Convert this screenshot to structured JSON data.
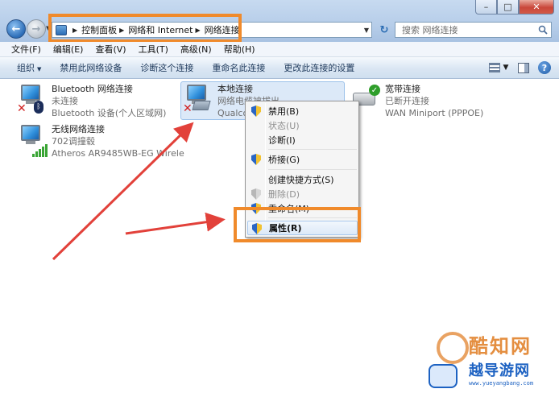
{
  "window": {
    "controls": {
      "minimize": "–",
      "maximize": "□",
      "close": "✕"
    }
  },
  "nav": {
    "back": "←",
    "forward": "→",
    "breadcrumbs": [
      "控制面板",
      "网络和 Internet",
      "网络连接"
    ],
    "refresh": "↻",
    "search_placeholder": "搜索 网络连接"
  },
  "menubar": [
    "文件(F)",
    "编辑(E)",
    "查看(V)",
    "工具(T)",
    "高级(N)",
    "帮助(H)"
  ],
  "commandbar": {
    "organize": "组织",
    "items": [
      "禁用此网络设备",
      "诊断这个连接",
      "重命名此连接",
      "更改此连接的设置"
    ]
  },
  "connections": [
    {
      "name": "Bluetooth 网络连接",
      "status": "未连接",
      "device": "Bluetooth 设备(个人区域网)",
      "icon": "bluetooth-monitor"
    },
    {
      "name": "无线网络连接",
      "status": "702调撞毂",
      "device": "Atheros AR9485WB-EG Wirele",
      "icon": "wireless-monitor"
    },
    {
      "name": "本地连接",
      "status": "网络电缆被拔出",
      "device": "Qualco",
      "icon": "lan-monitor"
    },
    {
      "name": "宽带连接",
      "status": "已断开连接",
      "device": "WAN Miniport (PPPOE)",
      "icon": "broadband-modem"
    }
  ],
  "context_menu": {
    "items": [
      {
        "label": "禁用(B)",
        "disabled": false,
        "shield": true
      },
      {
        "label": "状态(U)",
        "disabled": true,
        "shield": false
      },
      {
        "label": "诊断(I)",
        "disabled": false,
        "shield": false
      },
      {
        "label": "桥接(G)",
        "disabled": false,
        "shield": true
      },
      {
        "label": "创建快捷方式(S)",
        "disabled": false,
        "shield": false
      },
      {
        "label": "删除(D)",
        "disabled": true,
        "shield": true
      },
      {
        "label": "重命名(M)",
        "disabled": false,
        "shield": true
      },
      {
        "label": "属性(R)",
        "disabled": false,
        "shield": true,
        "bold": true
      }
    ]
  },
  "watermark": {
    "line1": "酷知网",
    "line2": "越导游网",
    "url": "www.yueyangbang.com"
  },
  "colors": {
    "highlight": "#f08a2b",
    "arrow": "#e2413a",
    "selection": "#dce9f8"
  }
}
